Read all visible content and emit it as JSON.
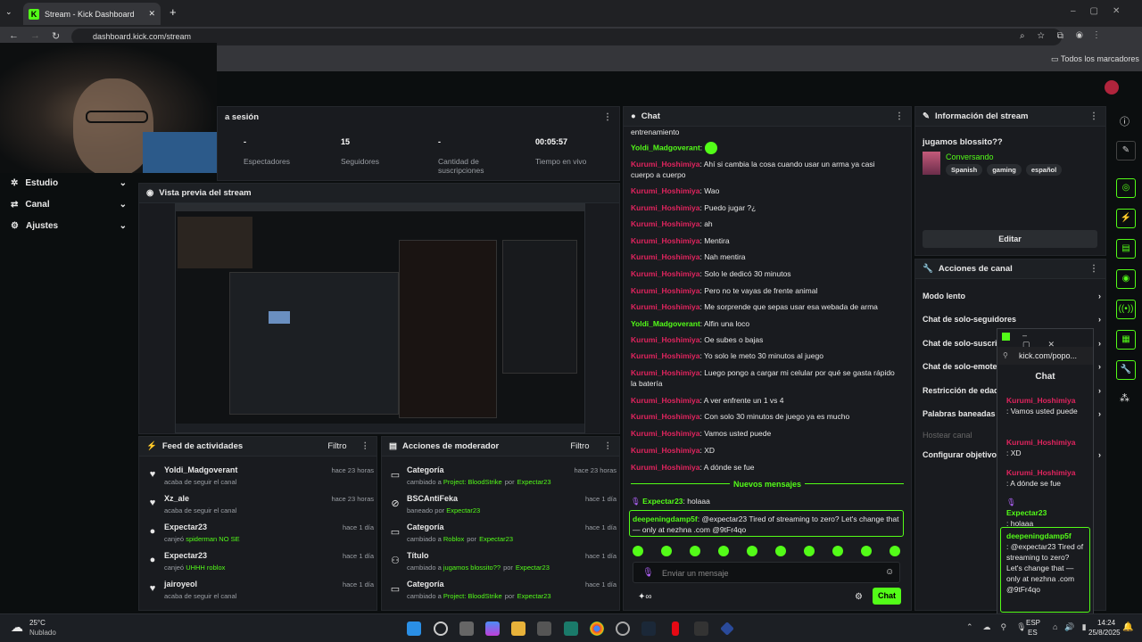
{
  "browser": {
    "tab_title": "Stream - Kick Dashboard",
    "url": "dashboard.kick.com/stream",
    "bookmarks": "Todos los marcadores"
  },
  "nav": [
    {
      "label": "Estudio",
      "icon": "studio-icon"
    },
    {
      "label": "Canal",
      "icon": "channel-icon"
    },
    {
      "label": "Ajustes",
      "icon": "gear-icon"
    }
  ],
  "session": {
    "title_fragment": "a sesión",
    "stats": [
      {
        "value": "-",
        "label": "Espectadores"
      },
      {
        "value": "15",
        "label": "Seguidores"
      },
      {
        "value": "-",
        "label": "Cantidad de suscripciones"
      },
      {
        "value": "00:05:57",
        "label": "Tiempo en vivo"
      }
    ]
  },
  "preview": {
    "title": "Vista previa del stream"
  },
  "feed": {
    "title": "Feed de actividades",
    "filter": "Filtro",
    "items": [
      {
        "name": "Yoldi_Madgoverant",
        "pre": "acaba de seguir el canal",
        "hl": "",
        "time": "hace 23 horas",
        "icon": "♥"
      },
      {
        "name": "Xz_ale",
        "pre": "acaba de seguir el canal",
        "hl": "",
        "time": "hace 23 horas",
        "icon": "♥"
      },
      {
        "name": "Expectar23",
        "pre": "canjeó ",
        "hl": "spiderman NO SE",
        "time": "hace 1 día",
        "icon": "●"
      },
      {
        "name": "Expectar23",
        "pre": "canjeó ",
        "hl": "UHHH roblox",
        "time": "hace 1 día",
        "icon": "●"
      },
      {
        "name": "jairoyeol",
        "pre": "acaba de seguir el canal",
        "hl": "",
        "time": "hace 1 día",
        "icon": "♥"
      }
    ]
  },
  "modactions": {
    "title": "Acciones de moderador",
    "filter": "Filtro",
    "items": [
      {
        "name": "Categoría",
        "pre": "cambiado a ",
        "hl": "Project: BloodStrike",
        "by": "Expectar23",
        "time": "hace 23 horas",
        "icon": "▭"
      },
      {
        "name": "BSCAntiFeka",
        "pre": "baneado por ",
        "hl": "",
        "by": "Expectar23",
        "time": "hace 1 día",
        "icon": "⊘"
      },
      {
        "name": "Categoría",
        "pre": "cambiado a ",
        "hl": "Roblox",
        "by": "Expectar23",
        "time": "hace 1 día",
        "icon": "▭"
      },
      {
        "name": "Título",
        "pre": "cambiado a ",
        "hl": "jugamos blossito??",
        "by": "Expectar23",
        "time": "hace 1 día",
        "icon": "⚇"
      },
      {
        "name": "Categoría",
        "pre": "cambiado a ",
        "hl": "Project: BloodStrike",
        "by": "Expectar23",
        "time": "hace 1 día",
        "icon": "▭"
      }
    ]
  },
  "chat": {
    "title": "Chat",
    "new_messages": "Nuevos mensajes",
    "placeholder": "Enviar un mensaje",
    "send": "Chat",
    "by_word": "por",
    "messages": [
      {
        "user": "",
        "text": "entrenamiento",
        "color": "pink"
      },
      {
        "user": "Yoldi_Madgoverant",
        "text": "",
        "color": "green",
        "emote": true
      },
      {
        "user": "Kurumi_Hoshimiya",
        "text": "Ahí si cambia la cosa cuando usar un arma ya casi cuerpo a cuerpo",
        "color": "pink"
      },
      {
        "user": "Kurumi_Hoshimiya",
        "text": "Wao",
        "color": "pink"
      },
      {
        "user": "Kurumi_Hoshimiya",
        "text": "Puedo jugar ?¿",
        "color": "pink"
      },
      {
        "user": "Kurumi_Hoshimiya",
        "text": "ah",
        "color": "pink"
      },
      {
        "user": "Kurumi_Hoshimiya",
        "text": "Mentira",
        "color": "pink"
      },
      {
        "user": "Kurumi_Hoshimiya",
        "text": "Nah mentira",
        "color": "pink"
      },
      {
        "user": "Kurumi_Hoshimiya",
        "text": "Solo le dedicó 30 minutos",
        "color": "pink"
      },
      {
        "user": "Kurumi_Hoshimiya",
        "text": "Pero no te vayas de frente animal",
        "color": "pink"
      },
      {
        "user": "Kurumi_Hoshimiya",
        "text": "Me sorprende que sepas usar esa webada de arma",
        "color": "pink"
      },
      {
        "user": "Yoldi_Madgoverant",
        "text": "Alfin una loco",
        "color": "green"
      },
      {
        "user": "Kurumi_Hoshimiya",
        "text": "Oe subes o bajas",
        "color": "pink"
      },
      {
        "user": "Kurumi_Hoshimiya",
        "text": "Yo solo le meto 30 minutos al juego",
        "color": "pink"
      },
      {
        "user": "Kurumi_Hoshimiya",
        "text": "Luego pongo a cargar mi celular por qué se gasta rápido la batería",
        "color": "pink"
      },
      {
        "user": "Kurumi_Hoshimiya",
        "text": "A ver enfrente un 1 vs 4",
        "color": "pink"
      },
      {
        "user": "Kurumi_Hoshimiya",
        "text": "Con solo 30 minutos de juego ya es mucho",
        "color": "pink"
      },
      {
        "user": "Kurumi_Hoshimiya",
        "text": "Vamos usted puede",
        "color": "pink"
      },
      {
        "user": "Kurumi_Hoshimiya",
        "text": "XD",
        "color": "pink"
      },
      {
        "user": "Kurumi_Hoshimiya",
        "text": "A dónde se fue",
        "color": "pink"
      }
    ],
    "after": [
      {
        "user": "Expectar23",
        "text": "holaaa"
      }
    ],
    "highlight": {
      "user": "deepeningdamp5f",
      "text": "@expectar23 Tired of streaming to zero? Let's change that — only at nezhna .com @9tFr4qo"
    }
  },
  "info": {
    "title": "Información del stream",
    "stream_title": "jugamos blossito??",
    "category": "Conversando",
    "tags": [
      "Spanish",
      "gaming",
      "español"
    ],
    "edit": "Editar"
  },
  "channel_actions": {
    "title": "Acciones de canal",
    "items": [
      "Modo lento",
      "Chat de solo-seguidores",
      "Chat de solo-suscript",
      "Chat de solo-emotes",
      "Restricción de edad",
      "Palabras baneadas",
      "Hostear canal",
      "Configurar objetivos"
    ]
  },
  "popup": {
    "url": "kick.com/popo...",
    "title": "Chat",
    "msgs": [
      {
        "user": "Kurumi_Hoshimiya",
        "text": ": Vamos usted puede",
        "color": "pink"
      },
      {
        "user": "Kurumi_Hoshimiya",
        "text": ": XD",
        "color": "pink"
      },
      {
        "user": "Kurumi_Hoshimiya",
        "text": ": A dónde se fue",
        "color": "pink"
      },
      {
        "user": "Expectar23",
        "text": ": holaaa",
        "color": "green"
      },
      {
        "user": "deepeningdamp5f",
        "text": ": @expectar23 Tired of streaming to zero? Let's change that — only at nezhna .com @9tFr4qo",
        "color": "green"
      }
    ]
  },
  "taskbar": {
    "temp": "25°C",
    "weather": "Nublado",
    "lang1": "ESP",
    "lang2": "ES",
    "time": "14:24",
    "date": "25/8/2025"
  }
}
